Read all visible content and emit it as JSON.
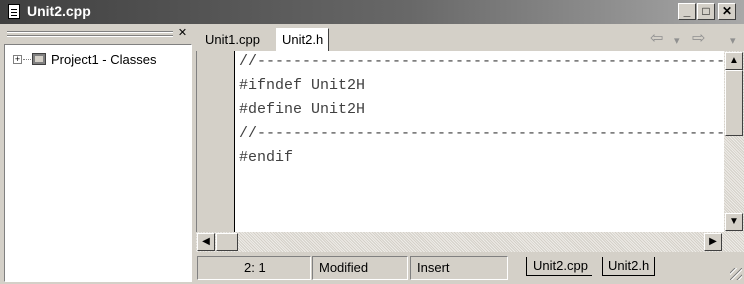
{
  "window": {
    "title": "Unit2.cpp",
    "minimize": "_",
    "maximize": "□",
    "close": "✕"
  },
  "left_pane": {
    "close_symbol": "✕",
    "tree": {
      "expander": "+",
      "root_label": "Project1 - Classes"
    }
  },
  "tabs": [
    {
      "label": "Unit1.cpp"
    },
    {
      "label": "Unit2.h"
    }
  ],
  "nav": {
    "back": "⇦",
    "forward": "⇨",
    "dropdown": "▾"
  },
  "code": {
    "lines": [
      "//------------------------------------------------------",
      "#ifndef Unit2H",
      "#define Unit2H",
      "//------------------------------------------------------",
      "#endif"
    ]
  },
  "scroll": {
    "up": "▲",
    "down": "▼",
    "left": "◀",
    "right": "▶"
  },
  "statusbar": {
    "position": "2:  1",
    "modified": "Modified",
    "mode": "Insert",
    "file_tabs": [
      "Unit2.cpp",
      "Unit2.h"
    ]
  }
}
